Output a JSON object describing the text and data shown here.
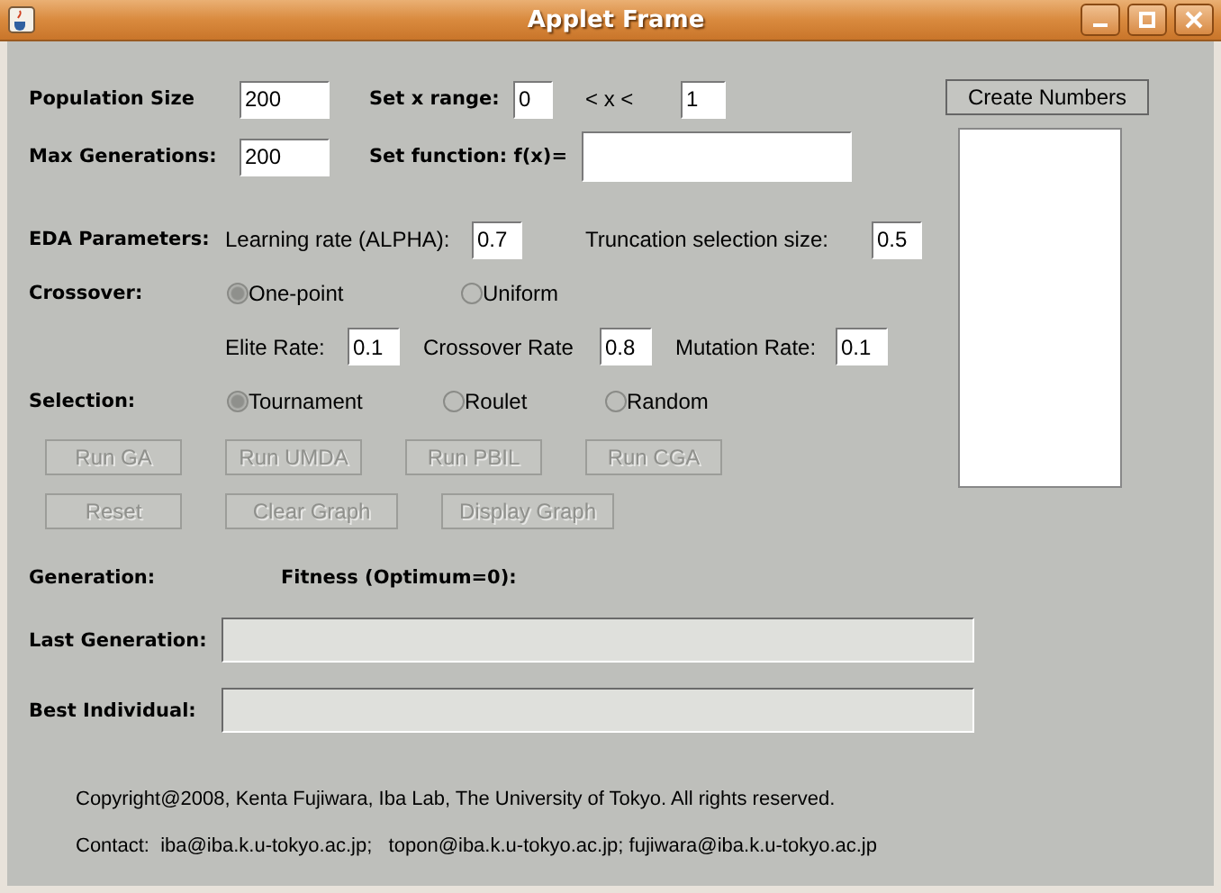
{
  "window": {
    "title": "Applet Frame"
  },
  "population_size": {
    "label": "Population Size",
    "value": "200"
  },
  "x_range": {
    "label": "Set x range:",
    "min": "0",
    "separator": "< x <",
    "max": "1"
  },
  "max_generations": {
    "label": "Max Generations:",
    "value": "200"
  },
  "function": {
    "label": "Set function: f(x)="
  },
  "create_numbers_button": {
    "label": "Create Numbers"
  },
  "eda": {
    "label": "EDA Parameters:",
    "learning_rate": {
      "label": "Learning rate (ALPHA):",
      "value": "0.7"
    },
    "truncation": {
      "label": "Truncation selection size:",
      "value": "0.5"
    }
  },
  "crossover": {
    "label": "Crossover:",
    "options": [
      {
        "label": "One-point",
        "selected": true
      },
      {
        "label": "Uniform",
        "selected": false
      }
    ]
  },
  "rates": [
    {
      "label": "Elite Rate:",
      "value": "0.1"
    },
    {
      "label": "Crossover Rate",
      "value": "0.8"
    },
    {
      "label": "Mutation Rate:",
      "value": "0.1"
    }
  ],
  "selection": {
    "label": "Selection:",
    "options": [
      {
        "label": "Tournament",
        "selected": true
      },
      {
        "label": "Roulet",
        "selected": false
      },
      {
        "label": "Random",
        "selected": false
      }
    ]
  },
  "run_buttons": [
    {
      "label": "Run GA",
      "disabled": true
    },
    {
      "label": "Run UMDA",
      "disabled": true
    },
    {
      "label": "Run PBIL",
      "disabled": true
    },
    {
      "label": "Run CGA",
      "disabled": true
    }
  ],
  "graph_buttons": [
    {
      "label": "Reset",
      "disabled": true
    },
    {
      "label": "Clear Graph",
      "disabled": true
    },
    {
      "label": "Display Graph",
      "disabled": true
    }
  ],
  "generation_label": "Generation:",
  "fitness_label": "Fitness (Optimum=0):",
  "outputs": [
    {
      "label": "Last Generation:"
    },
    {
      "label": "Best Individual:"
    }
  ],
  "footer": [
    "Copyright@2008, Kenta Fujiwara, Iba Lab, The University of Tokyo. All rights reserved.",
    "Contact:  iba@iba.k.u-tokyo.ac.jp;   topon@iba.k.u-tokyo.ac.jp; fujiwara@iba.k.u-tokyo.ac.jp"
  ]
}
